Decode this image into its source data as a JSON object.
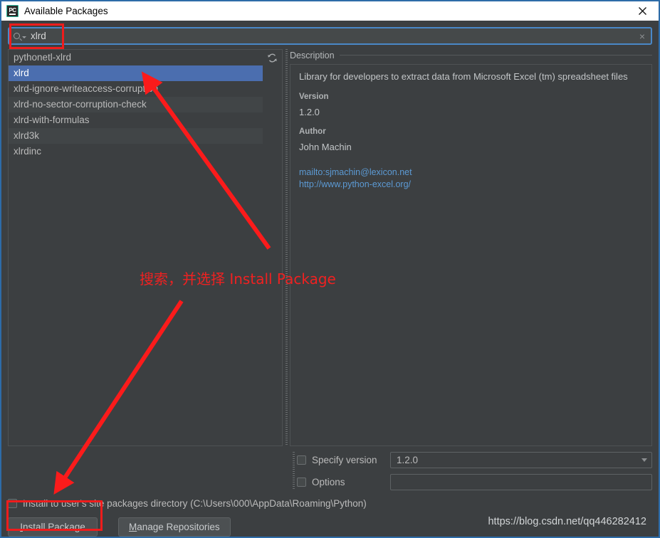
{
  "window": {
    "title": "Available Packages",
    "app_icon_label": "PC",
    "close_icon": "close-icon"
  },
  "search": {
    "value": "xlrd",
    "placeholder": "",
    "icon": "search-icon",
    "clear_icon": "×"
  },
  "package_list": {
    "refresh_icon": "refresh-icon",
    "items": [
      {
        "name": "pythonetl-xlrd",
        "selected": false
      },
      {
        "name": "xlrd",
        "selected": true
      },
      {
        "name": "xlrd-ignore-writeaccess-corruption",
        "selected": false
      },
      {
        "name": "xlrd-no-sector-corruption-check",
        "selected": false
      },
      {
        "name": "xlrd-with-formulas",
        "selected": false
      },
      {
        "name": "xlrd3k",
        "selected": false
      },
      {
        "name": "xlrdinc",
        "selected": false
      }
    ]
  },
  "description": {
    "group_title": "Description",
    "summary": "Library for developers to extract data from Microsoft Excel (tm) spreadsheet files",
    "version_label": "Version",
    "version_value": "1.2.0",
    "author_label": "Author",
    "author_value": "John Machin",
    "links": [
      "mailto:sjmachin@lexicon.net",
      "http://www.python-excel.org/"
    ]
  },
  "options": {
    "specify_version_label": "Specify version",
    "specify_version_checked": false,
    "version_value": "1.2.0",
    "options_label": "Options",
    "options_checked": false,
    "options_value": ""
  },
  "footer": {
    "install_user_checkbox_label": "Install to user's site packages directory (C:\\Users\\000\\AppData\\Roaming\\Python)",
    "install_user_checked": false,
    "install_button_mnemonic": "I",
    "install_button_rest": "nstall Package",
    "manage_button_mnemonic": "M",
    "manage_button_rest": "anage Repositories",
    "watermark": "https://blog.csdn.net/qq446282412"
  },
  "annotations": {
    "note_text": "搜索，并选择 Install Package",
    "highlight_color": "#f01c1c",
    "arrow_color": "#fb1b1b"
  },
  "colors": {
    "selection": "#4b6eaf",
    "window_border": "#2d6ca8",
    "focus_border": "#4a88c7",
    "link": "#5c9ad4",
    "background": "#3c3f41"
  }
}
